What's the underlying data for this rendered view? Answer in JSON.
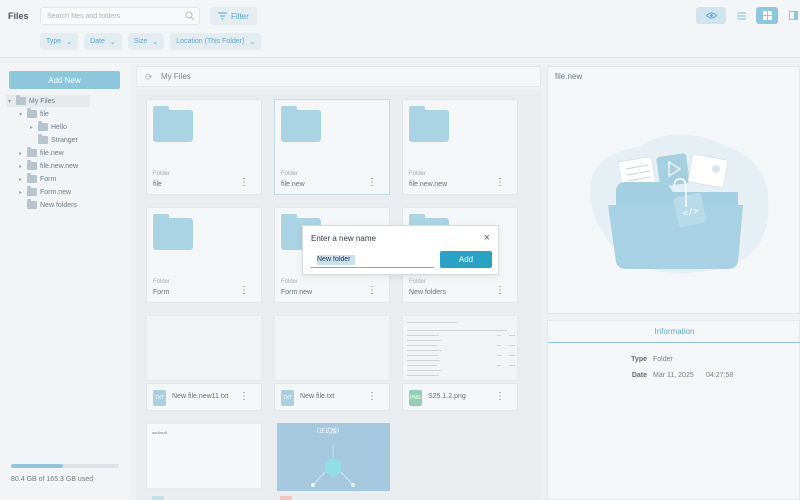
{
  "app": {
    "title": "Files"
  },
  "search": {
    "placeholder": "Search files and folders"
  },
  "filter": {
    "label": "Filter"
  },
  "chips": [
    {
      "label": "Type"
    },
    {
      "label": "Date"
    },
    {
      "label": "Size"
    },
    {
      "label": "Location (This Folder)"
    }
  ],
  "colors": {
    "accent": "#2aa2c6",
    "accent_light": "#8cc7de",
    "folder": "#aad3e3"
  },
  "sidebar": {
    "add_new_label": "Add New",
    "tree": [
      {
        "label": "My Files"
      },
      {
        "label": "file"
      },
      {
        "label": "Hello"
      },
      {
        "label": "Stranger"
      },
      {
        "label": "file.new"
      },
      {
        "label": "file.new.new"
      },
      {
        "label": "Form"
      },
      {
        "label": "Form.new"
      },
      {
        "label": "New folders"
      }
    ],
    "storage": {
      "text": "80.4 GB of 165.3 GB used",
      "fraction": 0.486
    }
  },
  "main": {
    "title": "My Files",
    "folders": [
      {
        "kind": "Folder",
        "name": "file"
      },
      {
        "kind": "Folder",
        "name": "file.new"
      },
      {
        "kind": "Folder",
        "name": "file.new.new"
      },
      {
        "kind": "Folder",
        "name": "Form"
      },
      {
        "kind": "Folder",
        "name": "Form.new"
      },
      {
        "kind": "Folder",
        "name": "New folders"
      }
    ],
    "files": [
      {
        "badge": "TXT",
        "name": "New file.new11.txt"
      },
      {
        "badge": "TXT",
        "name": "New file.txt"
      },
      {
        "badge": "PNG",
        "name": "S25.1.2.png"
      }
    ],
    "thumb_text": "asdfasdf",
    "thumb_banner": "（正式版）"
  },
  "dialog": {
    "title": "Enter a new name",
    "value": "New folder",
    "add_label": "Add"
  },
  "preview": {
    "title": "file.new"
  },
  "info": {
    "heading": "Information",
    "type_label": "Type",
    "type_value": "Folder",
    "date_label": "Date",
    "date_value": "Mar 11, 2025",
    "time_value": "04:27:58"
  }
}
